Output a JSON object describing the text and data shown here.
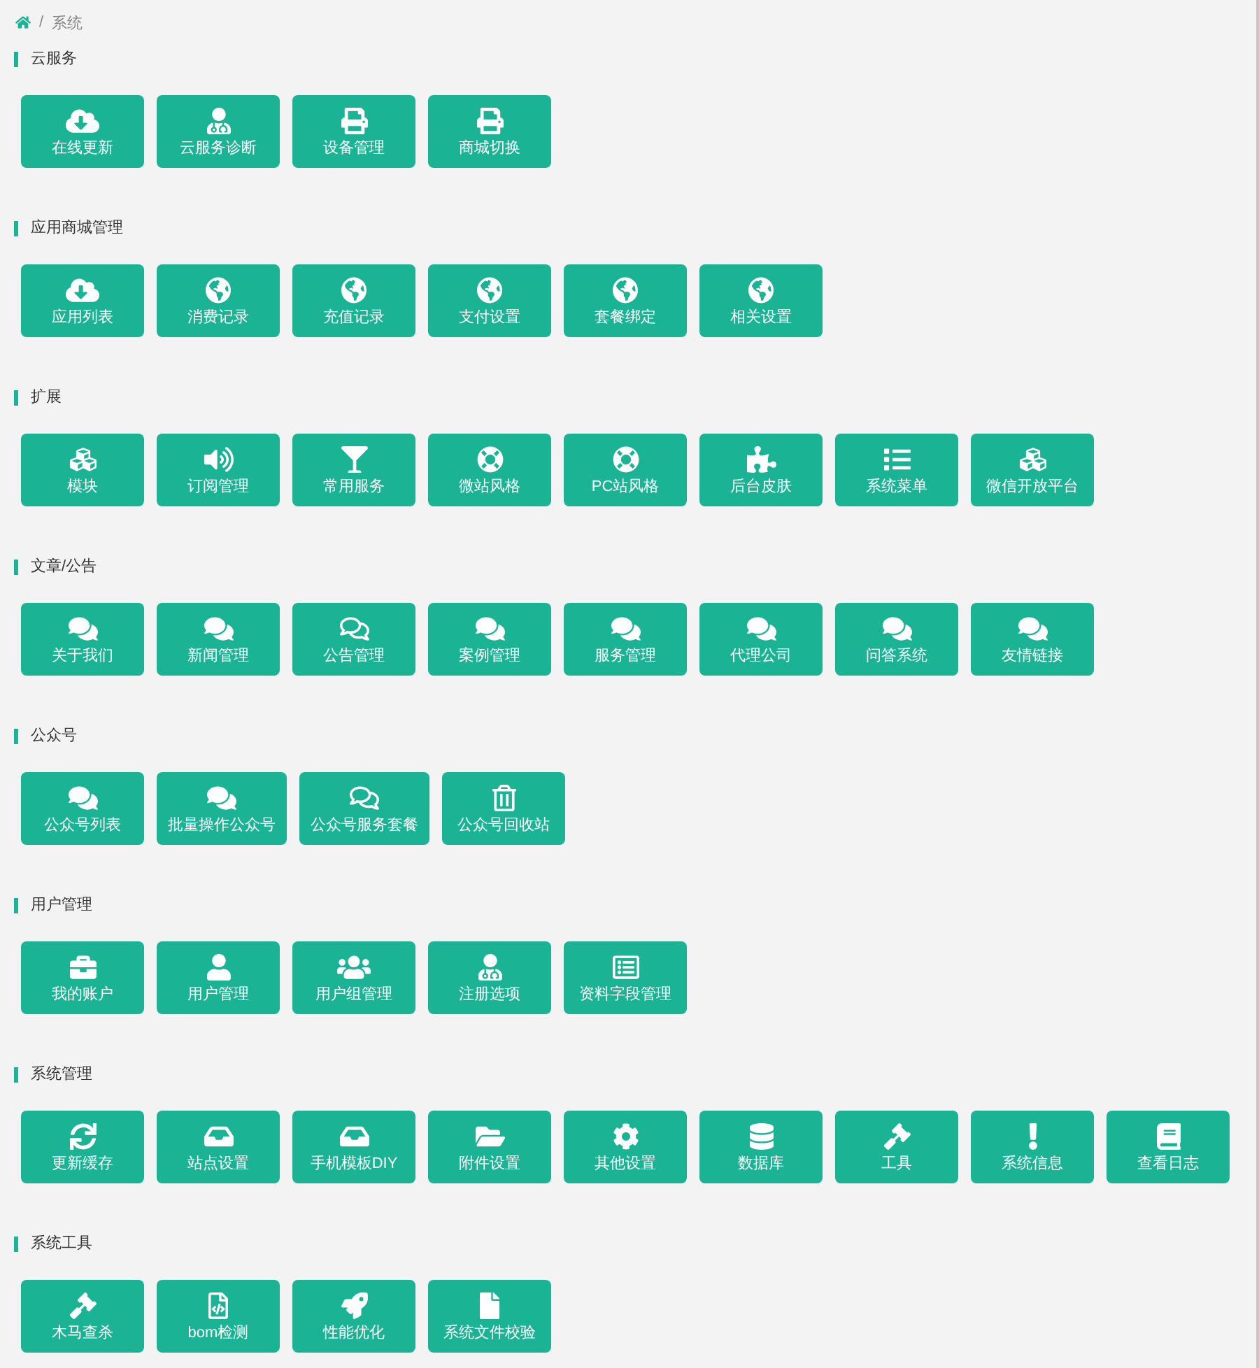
{
  "breadcrumb": {
    "separator": "/",
    "current": "系统"
  },
  "sections": [
    {
      "title": "云服务",
      "items": [
        {
          "label": "在线更新",
          "kind": "download"
        },
        {
          "label": "云服务诊断",
          "kind": "doctor"
        },
        {
          "label": "设备管理",
          "kind": "printer"
        },
        {
          "label": "商城切换",
          "kind": "printer"
        }
      ]
    },
    {
      "title": "应用商城管理",
      "items": [
        {
          "label": "应用列表",
          "kind": "download"
        },
        {
          "label": "消费记录",
          "kind": "globe"
        },
        {
          "label": "充值记录",
          "kind": "globe"
        },
        {
          "label": "支付设置",
          "kind": "globe"
        },
        {
          "label": "套餐绑定",
          "kind": "globe"
        },
        {
          "label": "相关设置",
          "kind": "globe"
        }
      ]
    },
    {
      "title": "扩展",
      "items": [
        {
          "label": "模块",
          "kind": "cubes"
        },
        {
          "label": "订阅管理",
          "kind": "speaker"
        },
        {
          "label": "常用服务",
          "kind": "glass"
        },
        {
          "label": "微站风格",
          "kind": "lifebuoy"
        },
        {
          "label": "PC站风格",
          "kind": "lifebuoy"
        },
        {
          "label": "后台皮肤",
          "kind": "puzzle"
        },
        {
          "label": "系统菜单",
          "kind": "list"
        },
        {
          "label": "微信开放平台",
          "kind": "cubes"
        }
      ]
    },
    {
      "title": "文章/公告",
      "items": [
        {
          "label": "关于我们",
          "kind": "chat"
        },
        {
          "label": "新闻管理",
          "kind": "chat"
        },
        {
          "label": "公告管理",
          "kind": "chatline"
        },
        {
          "label": "案例管理",
          "kind": "chat"
        },
        {
          "label": "服务管理",
          "kind": "chat"
        },
        {
          "label": "代理公司",
          "kind": "chat"
        },
        {
          "label": "问答系统",
          "kind": "chat"
        },
        {
          "label": "友情链接",
          "kind": "chat"
        }
      ]
    },
    {
      "title": "公众号",
      "items": [
        {
          "label": "公众号列表",
          "kind": "chat"
        },
        {
          "label": "批量操作公众号",
          "kind": "chat"
        },
        {
          "label": "公众号服务套餐",
          "kind": "chatline"
        },
        {
          "label": "公众号回收站",
          "kind": "trash"
        }
      ]
    },
    {
      "title": "用户管理",
      "items": [
        {
          "label": "我的账户",
          "kind": "briefcase"
        },
        {
          "label": "用户管理",
          "kind": "user"
        },
        {
          "label": "用户组管理",
          "kind": "users"
        },
        {
          "label": "注册选项",
          "kind": "doctor"
        },
        {
          "label": "资料字段管理",
          "kind": "sheet"
        }
      ]
    },
    {
      "title": "系统管理",
      "items": [
        {
          "label": "更新缓存",
          "kind": "refresh"
        },
        {
          "label": "站点设置",
          "kind": "inbox"
        },
        {
          "label": "手机模板DIY",
          "kind": "inbox"
        },
        {
          "label": "附件设置",
          "kind": "folder"
        },
        {
          "label": "其他设置",
          "kind": "gear"
        },
        {
          "label": "数据库",
          "kind": "database"
        },
        {
          "label": "工具",
          "kind": "gavel"
        },
        {
          "label": "系统信息",
          "kind": "alert"
        },
        {
          "label": "查看日志",
          "kind": "book"
        }
      ]
    },
    {
      "title": "系统工具",
      "items": [
        {
          "label": "木马查杀",
          "kind": "gavel"
        },
        {
          "label": "bom检测",
          "kind": "codefile"
        },
        {
          "label": "性能优化",
          "kind": "rocket"
        },
        {
          "label": "系统文件校验",
          "kind": "file"
        }
      ]
    }
  ]
}
